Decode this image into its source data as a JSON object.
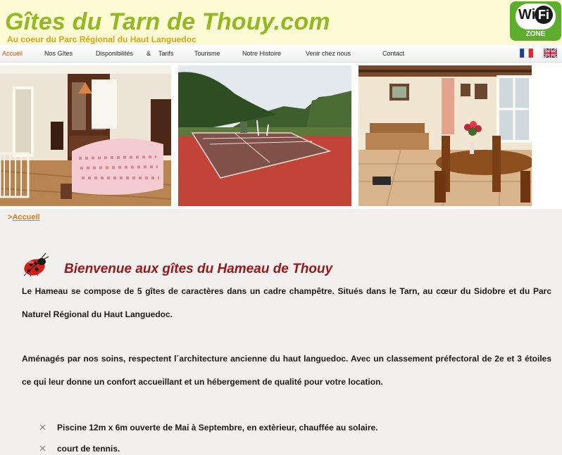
{
  "header": {
    "title": "Gîtes du Tarn de Thouy.com",
    "subtitle": "Au coeur du Parc Régional du Haut Languedoc",
    "wifi_badge": {
      "wi": "Wi",
      "fi": "Fi",
      "zone": "ZONE"
    }
  },
  "nav": {
    "items": [
      {
        "label": "Accueil",
        "active": true
      },
      {
        "label": "Nos Gîtes"
      },
      {
        "label": "Disponibilités"
      },
      {
        "label": "&"
      },
      {
        "label": "Tarifs"
      },
      {
        "label": "Tourisme"
      },
      {
        "label": "Notre Histoire"
      },
      {
        "label": "Venir chez nous"
      },
      {
        "label": "Contact"
      }
    ],
    "languages": [
      "french-flag-icon",
      "english-flag-icon"
    ]
  },
  "photos": [
    "bedroom-photo",
    "tennis-court-photo",
    "dining-room-photo"
  ],
  "breadcrumb": {
    "arrow": ">",
    "label": "Accueil"
  },
  "main": {
    "heading": "Bienvenue aux gîtes du Hameau de Thouy",
    "paragraphs": [
      "Le Hameau se compose de 5 gîtes de caractères dans un cadre champêtre. Situés dans le Tarn, au cœur du Sidobre et du Parc Naturel Régional du Haut Languedoc.",
      "Aménagés par nos soins, respectent l´architecture ancienne du haut languedoc. Avec un classement préfectoral de 2e et 3 étoiles ce qui leur donne un confort accueillant et un hébergement de qualité pour votre location."
    ],
    "bullets": [
      "Piscine 12m x 6m ouverte de Mai à Septembre, en extèrieur, chauffée au solaire.",
      "court de tennis."
    ]
  },
  "colors": {
    "title": "#92b824",
    "subtitle": "#d8a31d",
    "heading": "#9b1616",
    "link": "#e07a1f",
    "header_bg": "#fdfbd4",
    "content_bg": "#f1f0ef"
  }
}
